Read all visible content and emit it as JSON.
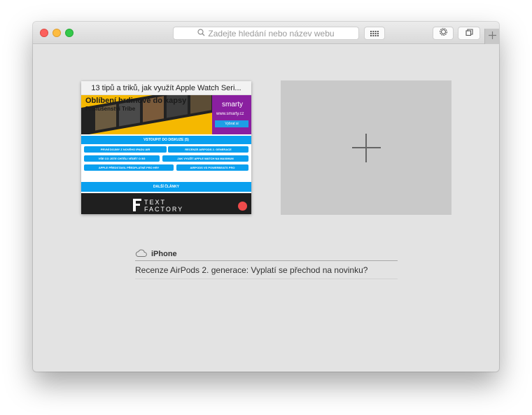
{
  "toolbar": {
    "search_placeholder": "Zadejte hledání nebo název webu",
    "icons": [
      "search-icon",
      "grid-icon",
      "gear-icon",
      "tabs-icon",
      "plus-icon"
    ]
  },
  "favorite_tile": {
    "title": "13 tipů a triků, jak využít Apple Watch Seri...",
    "banner_title": "Oblíbení hrdinové do kapsy",
    "banner_subtitle": "Příslušenství Tribe",
    "ad_logo": "smarty",
    "ad_url": "www.smarty.cz",
    "ad_button": "Vybrat si",
    "discuss_label": "VSTOUPIT DO DISKUZE (5)",
    "links": [
      "PRVNÍ DOJMY Z NOVÉHO IPADU AIR",
      "RECENZE AIRPODS 2. GENERACE",
      "VŠE CO JSTE CHTĚLI VĚDĚT O 5G",
      "JAK VYUŽÍT APPLE WATCH NA MAXIMUM",
      "APPLE PŘEDSTAVIL PŘEDPLATNÉ PRO HRY",
      "AIRPODS VS POWERBEATS PRO"
    ],
    "more_label": "DALŠÍ ČLÁNKY",
    "footer_brand_top": "TEXT",
    "footer_brand_bottom": "FACTORY"
  },
  "icloud_tabs": {
    "device": "iPhone",
    "items": [
      "Recenze AirPods 2. generace: Vyplatí se přechod na novinku?"
    ]
  }
}
